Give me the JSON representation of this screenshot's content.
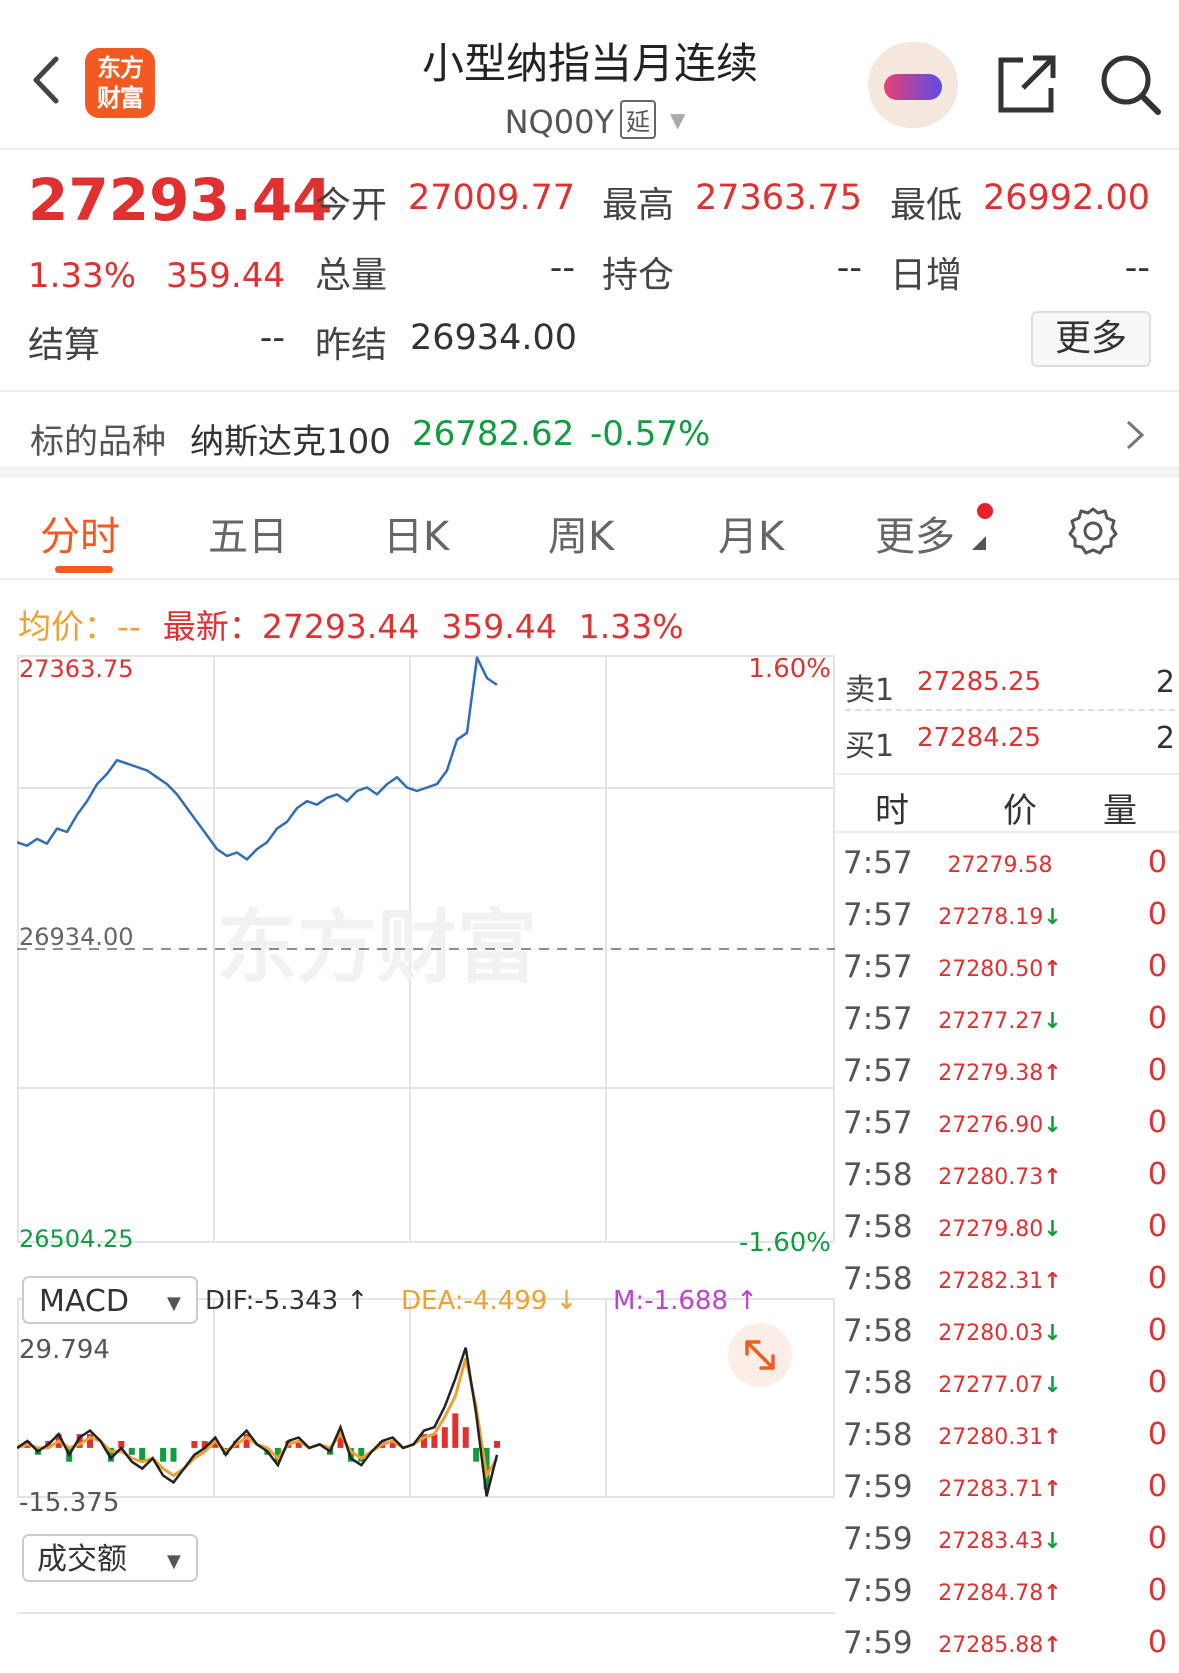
{
  "header": {
    "title": "小型纳指当月连续",
    "code": "NQ00Y",
    "delay_tag": "延",
    "logo_text": "东方财富"
  },
  "quote": {
    "price": "27293.44",
    "change_pct": "1.33%",
    "change": "359.44",
    "open_label": "今开",
    "open": "27009.77",
    "high_label": "最高",
    "high": "27363.75",
    "low_label": "最低",
    "low": "26992.00",
    "volume_label": "总量",
    "volume": "--",
    "position_label": "持仓",
    "position": "--",
    "daily_inc_label": "日增",
    "daily_inc": "--",
    "settle_label": "结算",
    "settle": "--",
    "prev_settle_label": "昨结",
    "prev_settle": "26934.00",
    "more_label": "更多"
  },
  "underlying": {
    "label": "标的品种",
    "name": "纳斯达克100",
    "price": "26782.62",
    "change_pct": "-0.57%"
  },
  "tabs": [
    "分时",
    "五日",
    "日K",
    "周K",
    "月K",
    "更多"
  ],
  "active_tab": 0,
  "info": {
    "avg_label": "均价：",
    "avg": "--",
    "latest_label": "最新：",
    "latest": "27293.44",
    "latest_change": "359.44",
    "latest_pct": "1.33%"
  },
  "chart_data": {
    "type": "line",
    "y_top_label": "27363.75",
    "y_mid_label": "26934.00",
    "y_bottom_label": "26504.25",
    "pct_top_label": "1.60%",
    "pct_bottom_label": "-1.60%",
    "ylim": [
      26504.25,
      27363.75
    ],
    "reference": 26934.0,
    "watermark": "东方财富",
    "series": [
      {
        "values": [
          27090,
          27085,
          27095,
          27088,
          27110,
          27105,
          27130,
          27150,
          27175,
          27190,
          27210,
          27205,
          27200,
          27195,
          27185,
          27175,
          27160,
          27140,
          27120,
          27100,
          27080,
          27070,
          27075,
          27065,
          27080,
          27090,
          27110,
          27120,
          27140,
          27150,
          27145,
          27155,
          27160,
          27150,
          27165,
          27170,
          27160,
          27175,
          27185,
          27170,
          27165,
          27170,
          27175,
          27195,
          27240,
          27250,
          27360,
          27330,
          27320
        ]
      }
    ],
    "macd": {
      "indicator": "MACD",
      "dif_label": "DIF:-5.343 ↑",
      "dea_label": "DEA:-4.499 ↓",
      "m_label": "M:-1.688 ↑",
      "ymax_label": "29.794",
      "ymin_label": "-15.375",
      "ylim": [
        -15.375,
        29.794
      ],
      "dif": [
        0,
        2,
        -1,
        1,
        4,
        -2,
        3,
        5,
        2,
        -3,
        0,
        -4,
        -6,
        -3,
        -8,
        -10,
        -6,
        -2,
        0,
        3,
        -2,
        2,
        5,
        1,
        -1,
        -5,
        2,
        3,
        0,
        1,
        -1,
        6,
        -3,
        -5,
        -1,
        2,
        3,
        0,
        1,
        5,
        6,
        12,
        20,
        29,
        10,
        -14,
        -2
      ],
      "dea": [
        0,
        1,
        0,
        0,
        2,
        0,
        1,
        3,
        2,
        -1,
        -1,
        -3,
        -4,
        -3,
        -6,
        -8,
        -6,
        -3,
        -1,
        2,
        -1,
        1,
        3,
        1,
        0,
        -3,
        1,
        2,
        0,
        1,
        0,
        4,
        -1,
        -3,
        -1,
        1,
        2,
        0,
        1,
        3,
        4,
        9,
        15,
        26,
        12,
        -8,
        -3
      ]
    },
    "volume_indicator": "成交额"
  },
  "order_book": {
    "sell_label": "卖1",
    "sell_price": "27285.25",
    "sell_qty": "2",
    "buy_label": "买1",
    "buy_price": "27284.25",
    "buy_qty": "2"
  },
  "ticks_header": [
    "时",
    "价",
    "量"
  ],
  "ticks": [
    {
      "time": "7:57",
      "price": "27279.58",
      "arrow": "",
      "qty": "0"
    },
    {
      "time": "7:57",
      "price": "27278.19",
      "arrow": "↓",
      "qty": "0"
    },
    {
      "time": "7:57",
      "price": "27280.50",
      "arrow": "↑",
      "qty": "0"
    },
    {
      "time": "7:57",
      "price": "27277.27",
      "arrow": "↓",
      "qty": "0"
    },
    {
      "time": "7:57",
      "price": "27279.38",
      "arrow": "↑",
      "qty": "0"
    },
    {
      "time": "7:57",
      "price": "27276.90",
      "arrow": "↓",
      "qty": "0"
    },
    {
      "time": "7:58",
      "price": "27280.73",
      "arrow": "↑",
      "qty": "0"
    },
    {
      "time": "7:58",
      "price": "27279.80",
      "arrow": "↓",
      "qty": "0"
    },
    {
      "time": "7:58",
      "price": "27282.31",
      "arrow": "↑",
      "qty": "0"
    },
    {
      "time": "7:58",
      "price": "27280.03",
      "arrow": "↓",
      "qty": "0"
    },
    {
      "time": "7:58",
      "price": "27277.07",
      "arrow": "↓",
      "qty": "0"
    },
    {
      "time": "7:58",
      "price": "27280.31",
      "arrow": "↑",
      "qty": "0"
    },
    {
      "time": "7:59",
      "price": "27283.71",
      "arrow": "↑",
      "qty": "0"
    },
    {
      "time": "7:59",
      "price": "27283.43",
      "arrow": "↓",
      "qty": "0"
    },
    {
      "time": "7:59",
      "price": "27284.78",
      "arrow": "↑",
      "qty": "0"
    },
    {
      "time": "7:59",
      "price": "27285.88",
      "arrow": "↑",
      "qty": "0"
    }
  ],
  "colors": {
    "up": "#e03030",
    "down": "#119c40",
    "accent": "#f25a22",
    "line": "#2f6db5",
    "dea": "#f0a030"
  }
}
